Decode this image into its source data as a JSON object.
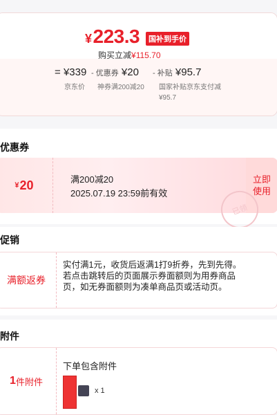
{
  "price_card": {
    "currency": "¥",
    "price": "223.3",
    "gov_badge": "国补到手价",
    "buy_reduce_label": "购买立减",
    "buy_reduce_amount": "¥115.70",
    "jd_price_value": "¥339",
    "jd_price_label": "京东价",
    "minus1": "=",
    "coupon_value": "¥20",
    "coupon_prefix": "- 优惠券",
    "coupon_label": "神券满200减20",
    "subsidy_prefix": "- 补贴",
    "subsidy_value": "¥95.7",
    "subsidy_label": "国家补贴京东支付减¥95.7"
  },
  "coupon_section": {
    "title": "优惠券",
    "amount_currency": "¥",
    "amount": "20",
    "rule": "满200减20",
    "expiry": "2025.07.19 23:59前有效",
    "button": "立即使用",
    "stamp": "已领"
  },
  "promo_section": {
    "title": "促销",
    "label": "满额返券",
    "text": "实付满1元，收货后返满1打9折券，先到先得。若点击跳转后的页面展示券面额则为用券商品页，如无券面额则为凑单商品页或活动页。"
  },
  "accessory_section": {
    "title": "附件",
    "count": "1",
    "count_suffix": "件附件",
    "heading": "下单包含附件",
    "qty": "x 1"
  }
}
